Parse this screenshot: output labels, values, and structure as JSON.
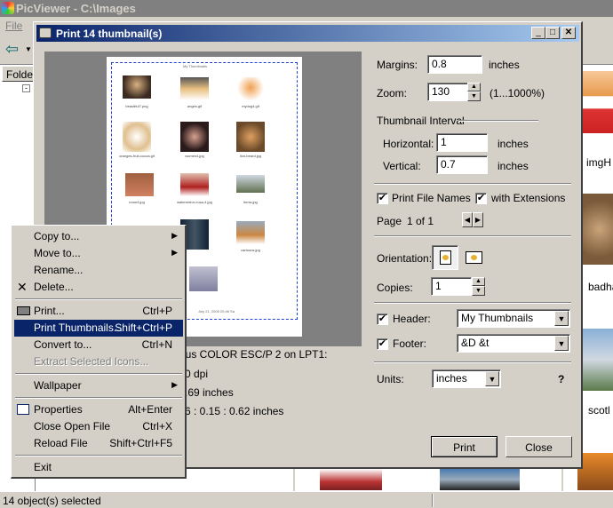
{
  "app": {
    "title": "PicViewer - C:\\Images",
    "menu_file": "File",
    "folder_label": "Folder",
    "status": "14 object(s) selected",
    "right_thumbs": [
      "imgH",
      "badha",
      "scotl"
    ]
  },
  "dialog": {
    "title": "Print 14 thumbnail(s)",
    "margins_label": "Margins:",
    "margins_value": "0.8",
    "margins_unit": "inches",
    "zoom_label": "Zoom:",
    "zoom_value": "130",
    "zoom_range": "(1...1000%)",
    "interval_title": "Thumbnail Interval",
    "horizontal_label": "Horizontal:",
    "horizontal_value": "1",
    "horizontal_unit": "inches",
    "vertical_label": "Vertical:",
    "vertical_value": "0.7",
    "vertical_unit": "inches",
    "print_file_names": "Print File Names",
    "with_extensions": "with Extensions",
    "page_label": "Page",
    "page_of": "1 of 1",
    "orientation_label": "Orientation:",
    "copies_label": "Copies:",
    "copies_value": "1",
    "header_label": "Header:",
    "header_value": "My Thumbnails",
    "footer_label": "Footer:",
    "footer_value": "&D &t",
    "units_label": "Units:",
    "units_value": "inches",
    "help": "?",
    "print_button": "Print",
    "close_button": "Close",
    "printer_line": "lus COLOR ESC/P 2 on LPT1:",
    "dpi_line": "0 dpi",
    "size_line": ".69 inches",
    "margin_line": "6 : 0.15 : 0.62 inches"
  },
  "preview": {
    "page_header": "My Thumbnails",
    "captions": [
      "beautiful7.png",
      "anges.gif",
      "mydog4.gif",
      "oranges-fruit-cocoa.gif",
      "women4.jpg",
      "lion-beard.jpg",
      "rome4.jpg",
      "watermelon-rosa-4.jpg",
      "tierra.jpg",
      "",
      "",
      "cartoons.jpg"
    ],
    "footer": "July 21, 2005 20:46 Sa"
  },
  "context_menu": {
    "items": [
      {
        "label": "Copy to...",
        "shortcut": ""
      },
      {
        "label": "Move to...",
        "shortcut": ""
      },
      {
        "label": "Rename...",
        "shortcut": ""
      },
      {
        "label": "Delete...",
        "shortcut": ""
      },
      {
        "label": "Print...",
        "shortcut": "Ctrl+P"
      },
      {
        "label": "Print Thumbnails...",
        "shortcut": "Shift+Ctrl+P"
      },
      {
        "label": "Convert to...",
        "shortcut": "Ctrl+N"
      },
      {
        "label": "Extract Selected Icons...",
        "shortcut": ""
      },
      {
        "label": "Wallpaper",
        "shortcut": ""
      },
      {
        "label": "Properties",
        "shortcut": "Alt+Enter"
      },
      {
        "label": "Close Open File",
        "shortcut": "Ctrl+X"
      },
      {
        "label": "Reload File",
        "shortcut": "Shift+Ctrl+F5"
      },
      {
        "label": "Exit",
        "shortcut": ""
      }
    ]
  },
  "colors": {
    "title_bar": "#0a246a",
    "menu_highlight": "#0a246a",
    "dialog_face": "#d4d0c8"
  }
}
